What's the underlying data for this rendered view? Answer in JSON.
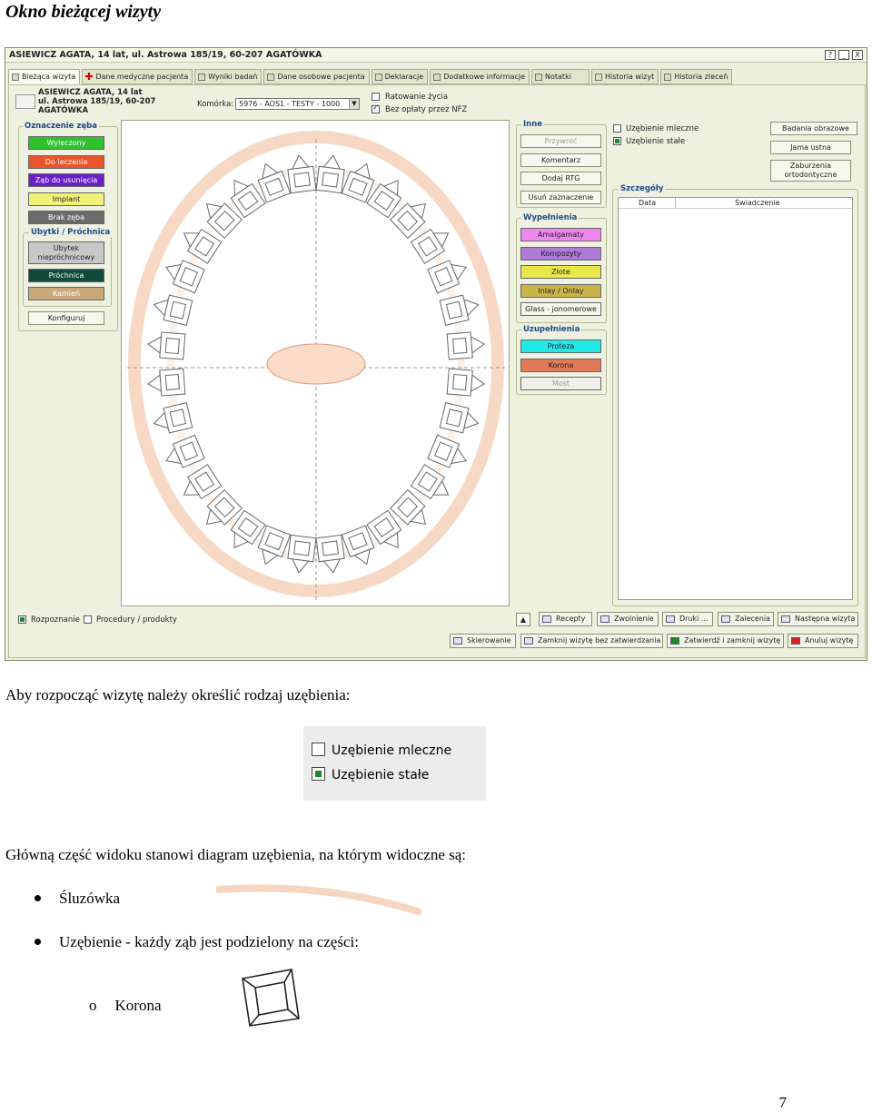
{
  "doc": {
    "heading": "Okno bieżącej wizyty",
    "para1": "Aby rozpocząć wizytę należy określić rodzaj uzębienia:",
    "para2": "Główną część widoku stanowi diagram uzębienia, na którym widoczne są:",
    "bullets": [
      "Śluzówka",
      "Uzębienie - każdy ząb jest podzielony na części:"
    ],
    "subbullets": [
      "Korona"
    ],
    "subbullet_marker": "o",
    "page_number": "7"
  },
  "selection_image": {
    "option1": "Uzębienie mleczne",
    "option2": "Uzębienie stałe"
  },
  "app": {
    "title": "ASIEWICZ AGATA, 14 lat, ul. Astrowa 185/19, 60-207 AGATÓWKA",
    "window_buttons": [
      "?",
      "_",
      "X"
    ],
    "tabs": [
      {
        "label": "Bieżąca wizyta",
        "active": true
      },
      {
        "label": "Dane medyczne pacjenta"
      },
      {
        "label": "Wyniki badań"
      },
      {
        "label": "Dane osobowe pacjenta"
      },
      {
        "label": "Deklaracje"
      },
      {
        "label": "Dodatkowe informacje"
      },
      {
        "label": "Notatki"
      },
      {
        "label": "Historia wizyt"
      },
      {
        "label": "Historia zleceń"
      }
    ],
    "patient": {
      "line1": "ASIEWICZ AGATA, 14 lat",
      "line2": "ul. Astrowa 185/19, 60-207",
      "line3": "AGATÓWKA"
    },
    "komorka_label": "Komórka:",
    "komorka_value": "5976 - AOS1 - TESTY - 1000",
    "ratowanie": "Ratowanie życia",
    "bez_oplaty": "Bez opłaty przez NFZ",
    "oznaczenie": {
      "title": "Oznaczenie zęba",
      "buttons": [
        {
          "label": "Wyleczony",
          "color": "#2fbf2f"
        },
        {
          "label": "Do leczenia",
          "color": "#e9552a"
        },
        {
          "label": "Ząb do usunięcia",
          "color": "#6a1fc7"
        },
        {
          "label": "Implant",
          "color": "#f2f27a"
        },
        {
          "label": "Brak zęba",
          "color": "#6b6b6b"
        }
      ]
    },
    "ubytki": {
      "title": "Ubytki / Próchnica",
      "buttons": [
        {
          "label": "Ubytek niepróchnicowy",
          "color": "#c8c8c8"
        },
        {
          "label": "Próchnica",
          "color": "#0f4a3a"
        },
        {
          "label": "Kamień",
          "color": "#c9a97a"
        }
      ]
    },
    "konfiguruj": "Konfiguruj",
    "inne": {
      "title": "Inne",
      "buttons": [
        "Przywróć",
        "Komentarz",
        "Dodaj RTG",
        "Usuń zaznaczenie"
      ]
    },
    "wypelnienia": {
      "title": "Wypełnienia",
      "buttons": [
        {
          "label": "Amalgamaty",
          "color": "#ee88ee"
        },
        {
          "label": "Kompozyty",
          "color": "#b07ad8"
        },
        {
          "label": "Złote",
          "color": "#e8e84a"
        },
        {
          "label": "Inlay / Onlay",
          "color": "#c9b44a"
        },
        {
          "label": "Glass - jonomerowe",
          "color": "#f6f6ee"
        }
      ]
    },
    "uzupelnienia": {
      "title": "Uzupełnienia",
      "buttons": [
        {
          "label": "Proteza",
          "color": "#22e8e8"
        },
        {
          "label": "Korona",
          "color": "#e27a5a"
        },
        {
          "label": "Most",
          "color": "#f0f0e8"
        }
      ]
    },
    "uz_mleczne": "Uzębienie mleczne",
    "uz_stale": "Uzębienie stałe",
    "right_buttons": [
      "Badania obrazowe",
      "Jama ustna",
      "Zaburzenia ortodontyczne"
    ],
    "szczegoly": {
      "title": "Szczegóły",
      "col1": "Data",
      "col2": "Świadczenie"
    },
    "rozpoznanie": "Rozpoznanie",
    "procedury": "Procedury / produkty",
    "bottom_row1": [
      "Recepty",
      "Zwolnienie",
      "Druki ...",
      "Zalecenia",
      "Następna wizyta"
    ],
    "bottom_row2": [
      "Skierowanie",
      "Zamknij wizytę bez zatwierdzania",
      "Zatwierdź i zamknij wizytę",
      "Anuluj wizytę"
    ]
  }
}
